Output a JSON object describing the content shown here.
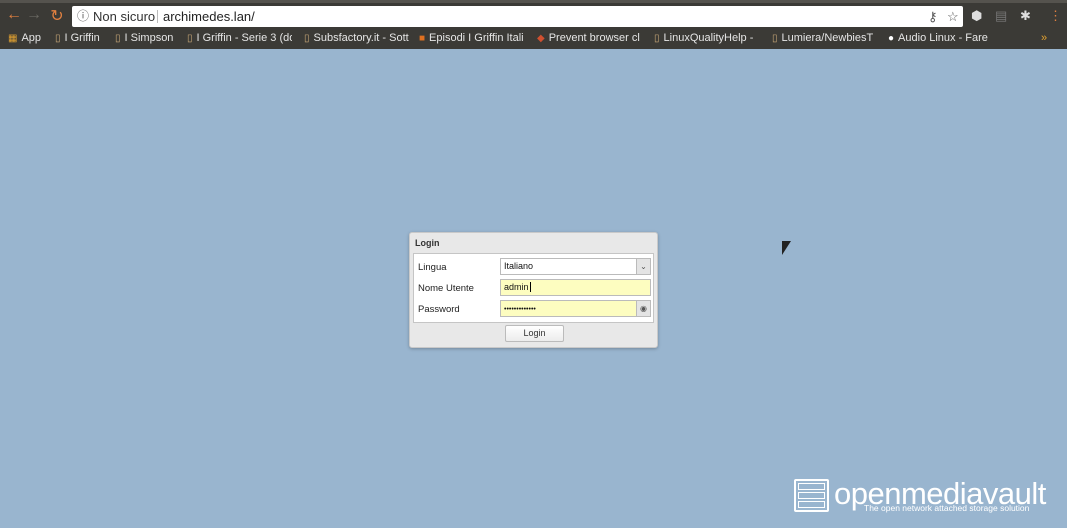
{
  "browser": {
    "security_label": "Non sicuro",
    "url": "archimedes.lan/",
    "bookmarks": [
      {
        "label": "App",
        "icon": "apps-grid-icon"
      },
      {
        "label": "I Griffin",
        "icon": "page-icon"
      },
      {
        "label": "I Simpson",
        "icon": "page-icon"
      },
      {
        "label": "I Griffin - Serie 3 (do",
        "icon": "page-icon"
      },
      {
        "label": "Subsfactory.it - Sott",
        "icon": "page-icon"
      },
      {
        "label": "Episodi I Griffin Itali",
        "icon": "site-icon"
      },
      {
        "label": "Prevent browser cl",
        "icon": "site-icon"
      },
      {
        "label": "LinuxQualityHelp -",
        "icon": "page-icon"
      },
      {
        "label": "Lumiera/NewbiesT",
        "icon": "page-icon"
      },
      {
        "label": "Audio Linux - Fare",
        "icon": "site-icon"
      }
    ],
    "overflow": "»"
  },
  "login": {
    "title": "Login",
    "language_label": "Lingua",
    "language_value": "Italiano",
    "username_label": "Nome Utente",
    "username_value": "admin",
    "password_label": "Password",
    "password_value": "•••••••••••••",
    "submit_label": "Login"
  },
  "brand": {
    "name": "openmediavault",
    "tagline": "The open network attached storage solution"
  }
}
